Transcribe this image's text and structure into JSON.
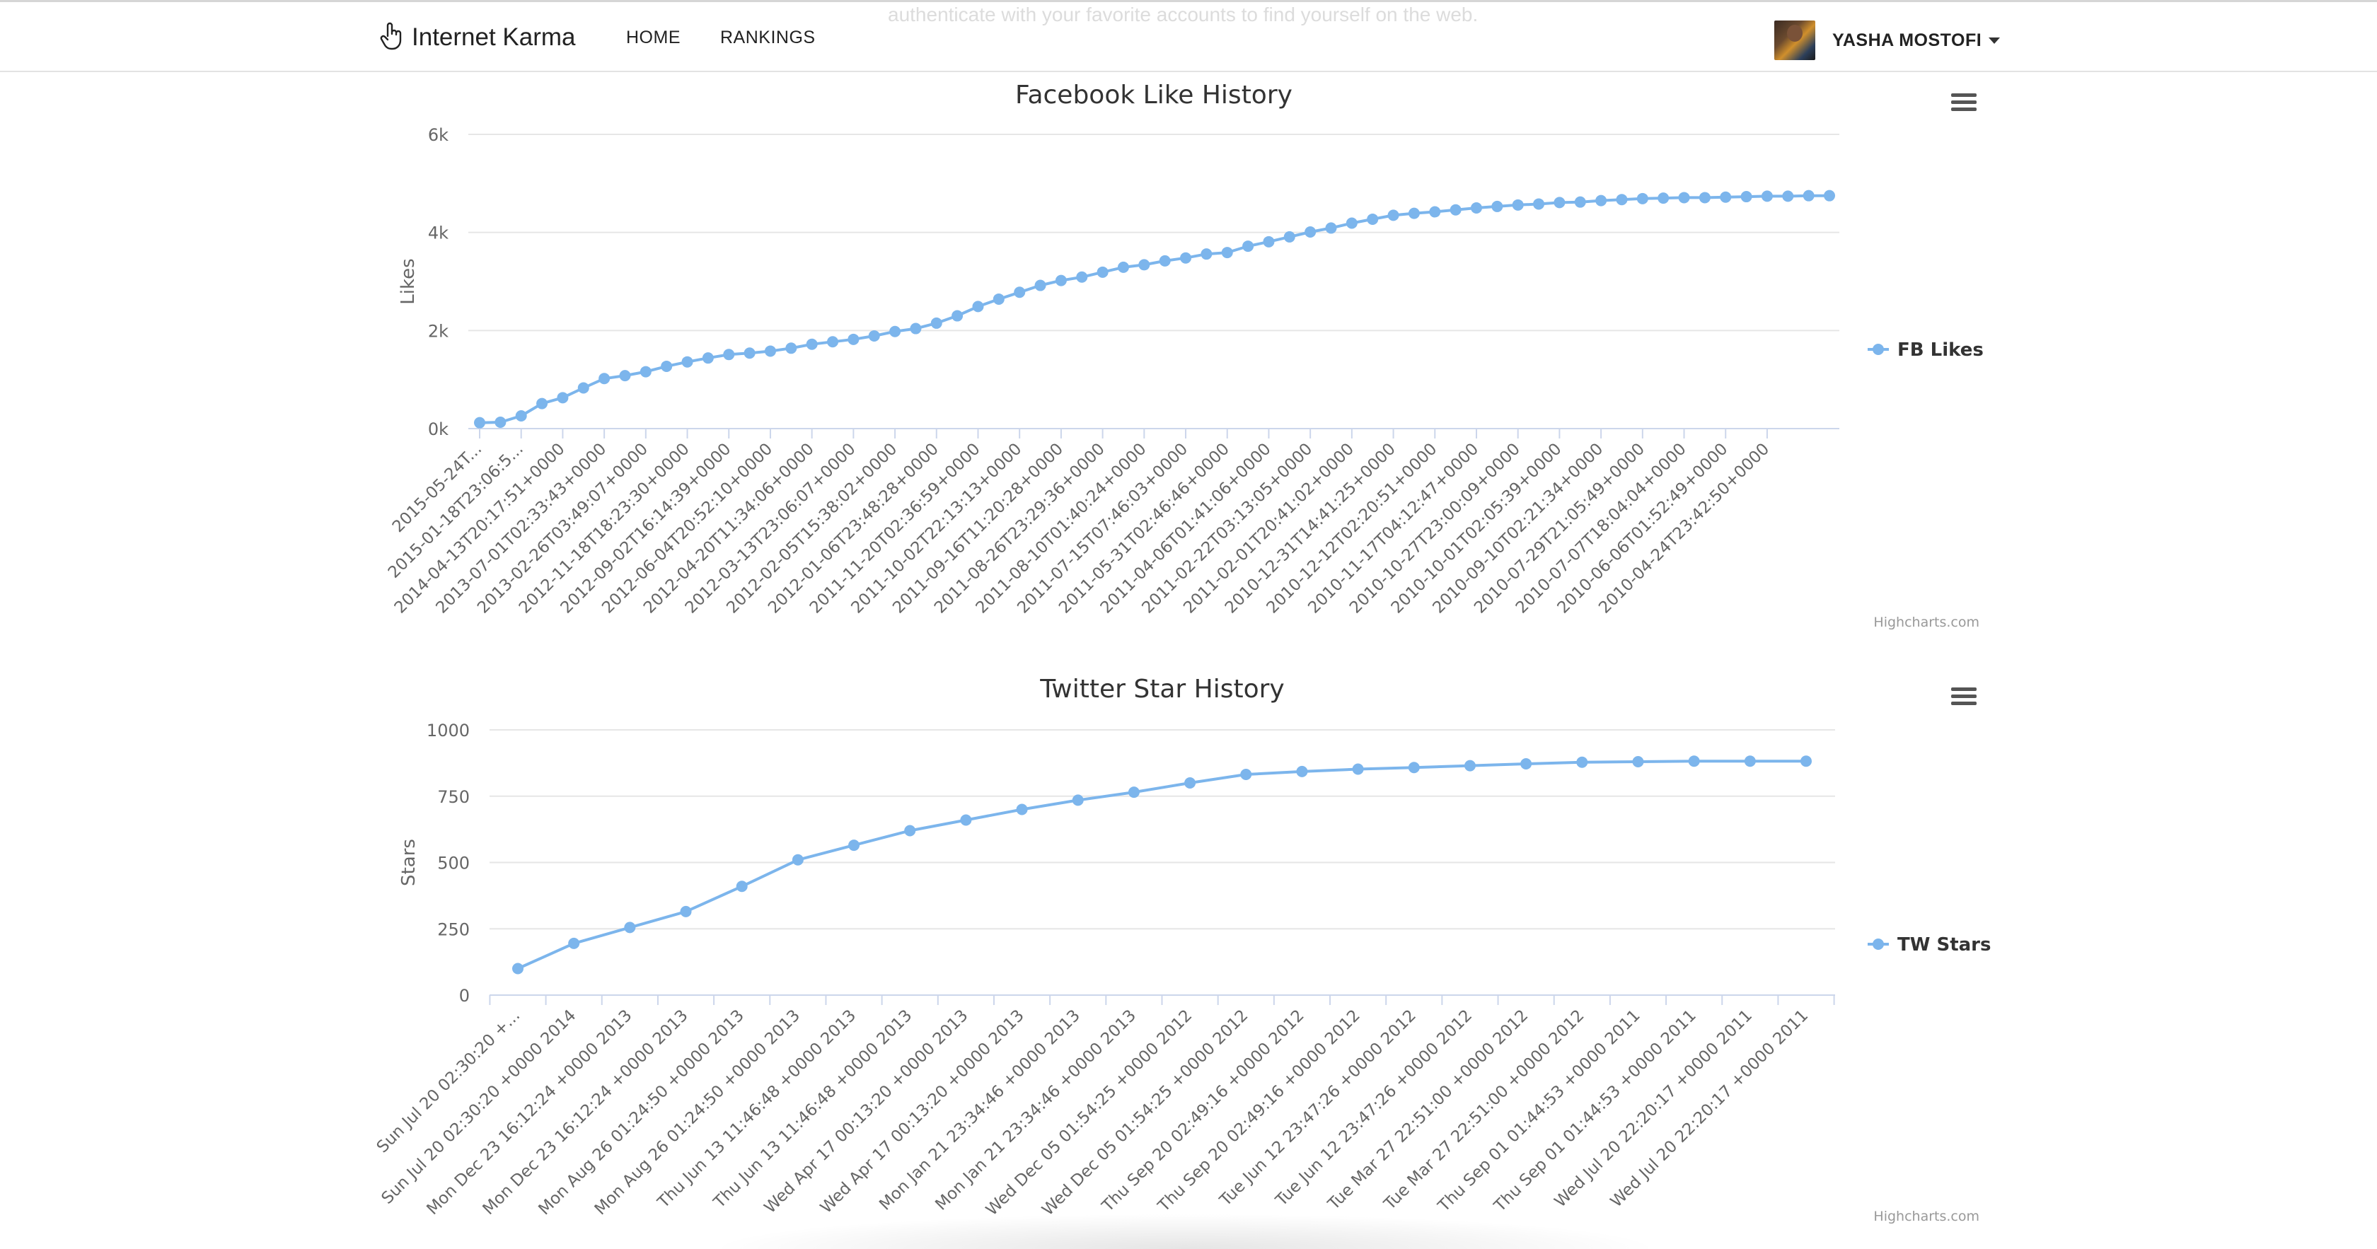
{
  "header": {
    "brand": "Internet Karma",
    "brand_icon": "hand-pointer-icon",
    "faint_text": "authenticate with your favorite accounts to find yourself on the web.",
    "nav": [
      "HOME",
      "RANKINGS"
    ],
    "user_name": "YASHA MOSTOFI"
  },
  "colors": {
    "series": "#7cb5ec",
    "grid": "#e6e6e6",
    "axis_text": "#666666",
    "title": "#333333"
  },
  "chart_data": [
    {
      "type": "line",
      "title": "Facebook Like History",
      "ylabel": "Likes",
      "xlabel": "",
      "ylim": [
        0,
        6000
      ],
      "yticks": [
        "0k",
        "2k",
        "4k",
        "6k"
      ],
      "legend_position": "right",
      "credits": "Highcharts.com",
      "categories": [
        "2015-05-24T...",
        "2015-01-18T23:06:5...",
        "2014-04-13T20:17:51+0000",
        "2013-07-01T02:33:43+0000",
        "2013-02-26T03:49:07+0000",
        "2012-11-18T18:23:30+0000",
        "2012-09-02T16:14:39+0000",
        "2012-06-04T20:52:10+0000",
        "2012-04-20T11:34:06+0000",
        "2012-03-13T23:06:07+0000",
        "2012-02-05T15:38:02+0000",
        "2012-01-06T23:48:28+0000",
        "2011-11-20T02:36:59+0000",
        "2011-10-02T22:13:13+0000",
        "2011-09-16T11:20:28+0000",
        "2011-08-26T23:29:36+0000",
        "2011-08-10T01:40:24+0000",
        "2011-07-15T07:46:03+0000",
        "2011-05-31T02:46:46+0000",
        "2011-04-06T01:41:06+0000",
        "2011-02-22T03:13:05+0000",
        "2011-02-01T20:41:02+0000",
        "2010-12-31T14:41:25+0000",
        "2010-12-12T02:20:51+0000",
        "2010-11-17T04:12:47+0000",
        "2010-10-27T23:00:09+0000",
        "2010-10-01T02:05:39+0000",
        "2010-09-10T02:21:34+0000",
        "2010-07-29T21:05:49+0000",
        "2010-07-07T18:04:04+0000",
        "2010-06-06T01:52:49+0000",
        "2010-04-24T23:42:50+0000"
      ],
      "series": [
        {
          "name": "FB Likes",
          "values": [
            120,
            130,
            260,
            510,
            630,
            830,
            1020,
            1080,
            1160,
            1270,
            1360,
            1440,
            1510,
            1540,
            1580,
            1640,
            1720,
            1770,
            1820,
            1890,
            1980,
            2040,
            2150,
            2300,
            2490,
            2640,
            2780,
            2920,
            3020,
            3090,
            3190,
            3290,
            3340,
            3420,
            3480,
            3560,
            3590,
            3720,
            3810,
            3910,
            4010,
            4090,
            4190,
            4270,
            4350,
            4390,
            4420,
            4460,
            4500,
            4530,
            4560,
            4580,
            4610,
            4620,
            4650,
            4670,
            4690,
            4700,
            4710,
            4710,
            4720,
            4730,
            4740,
            4740,
            4750,
            4750
          ]
        }
      ]
    },
    {
      "type": "line",
      "title": "Twitter Star History",
      "ylabel": "Stars",
      "xlabel": "",
      "ylim": [
        0,
        1000
      ],
      "yticks": [
        "0",
        "250",
        "500",
        "750",
        "1000"
      ],
      "legend_position": "right",
      "credits": "Highcharts.com",
      "categories": [
        "Sun Jul 20 02:30:20 +...",
        "Sun Jul 20 02:30:20 +0000 2014",
        "Mon Dec 23 16:12:24 +0000 2013",
        "Mon Dec 23 16:12:24 +0000 2013",
        "Mon Aug 26 01:24:50 +0000 2013",
        "Mon Aug 26 01:24:50 +0000 2013",
        "Thu Jun 13 11:46:48 +0000 2013",
        "Thu Jun 13 11:46:48 +0000 2013",
        "Wed Apr 17 00:13:20 +0000 2013",
        "Wed Apr 17 00:13:20 +0000 2013",
        "Mon Jan 21 23:34:46 +0000 2013",
        "Mon Jan 21 23:34:46 +0000 2013",
        "Wed Dec 05 01:54:25 +0000 2012",
        "Wed Dec 05 01:54:25 +0000 2012",
        "Thu Sep 20 02:49:16 +0000 2012",
        "Thu Sep 20 02:49:16 +0000 2012",
        "Tue Jun 12 23:47:26 +0000 2012",
        "Tue Jun 12 23:47:26 +0000 2012",
        "Tue Mar 27 22:51:00 +0000 2012",
        "Tue Mar 27 22:51:00 +0000 2012",
        "Thu Sep 01 01:44:53 +0000 2011",
        "Thu Sep 01 01:44:53 +0000 2011",
        "Wed Jul 20 22:20:17 +0000 2011",
        "Wed Jul 20 22:20:17 +0000 2011"
      ],
      "series": [
        {
          "name": "TW Stars",
          "values": [
            100,
            195,
            255,
            315,
            410,
            510,
            565,
            620,
            660,
            700,
            735,
            765,
            800,
            832,
            843,
            852,
            858,
            865,
            872,
            878,
            880,
            882,
            882,
            882
          ]
        }
      ]
    }
  ]
}
